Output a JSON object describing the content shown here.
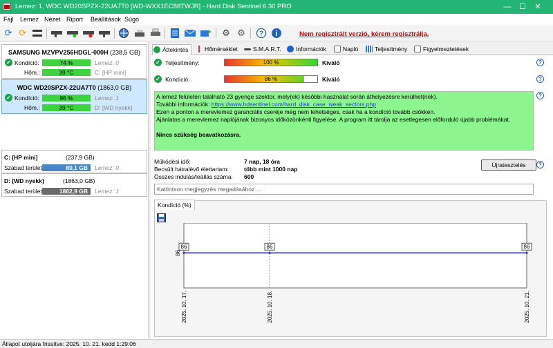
{
  "window": {
    "title": "Lemez: 1, WDC WD20SPZX-22UA7T0 [WD-WXX1EC88TWJR]  -  Hard Disk Sentinel 6.30 PRO",
    "controls": [
      "—",
      "☐",
      "✕"
    ]
  },
  "menu": [
    "Fájl",
    "Lemez",
    "Nézet",
    "Riport",
    "Beállítások",
    "Súgó"
  ],
  "toolbar": {
    "icons": [
      "refresh-icon",
      "warning-refresh-icon",
      "disk-list-icon",
      "disk-icon",
      "disk-green-icon",
      "disk-red-icon",
      "disk-remove-icon",
      "globe-icon",
      "scanner-icon",
      "printer-icon",
      "report-icon",
      "mail-icon",
      "mail-send-icon",
      "settings-gear-icon",
      "wrench-icon",
      "help-icon",
      "info-icon"
    ],
    "register_message": "Nem regisztrált verzió, kérem regisztrálja."
  },
  "disks": [
    {
      "name": "SAMSUNG MZVPV256HDGL-000H",
      "size": "(238,5 GB)",
      "kondicio_label": "Kondíció:",
      "kondicio": "74 %",
      "lemez": "Lemez: 0",
      "hom_label": "Hőm.:",
      "temp": "39 °C",
      "drive": "C: [HP mini]"
    },
    {
      "name": "WDC WD20SPZX-22UA7T0",
      "size": "(1863,0 GB)",
      "kondicio_label": "Kondíció:",
      "kondicio": "86 %",
      "lemez": "Lemez: 1",
      "hom_label": "Hőm.:",
      "temp": "39 °C",
      "drive": "D: [WD nyekk]"
    }
  ],
  "volumes": [
    {
      "name": "C: [HP mini]",
      "size": "(237,9 GB)",
      "free_label": "Szabad terület",
      "free": "80,1 GB",
      "free_fraction": 0.337,
      "disk": "Lemez: 0"
    },
    {
      "name": "D: [WD nyekk]",
      "size": "(1863,0 GB)",
      "free_label": "Szabad terület",
      "free": "1862,9 GB",
      "free_fraction": 0.999,
      "disk": "Lemez: 1"
    }
  ],
  "tabs": [
    "Áttekintés",
    "Hőmérséklet",
    "S.M.A.R.T.",
    "Információk",
    "Napló",
    "Teljesítmény",
    "Figyelmeztetések"
  ],
  "overview": {
    "perf_label": "Teljesítmény:",
    "perf_value": "100 %",
    "perf_fraction": 1.0,
    "perf_rating": "Kiváló",
    "health_label": "Kondíció:",
    "health_value": "86 %",
    "health_fraction": 0.86,
    "health_rating": "Kiváló",
    "message_line1": "A lemez felületén található 23 gyenge szektor, mely(ek) későbbi használat során áthelyezésre kerülhet(nek).",
    "message_more_label": "További információk: ",
    "message_link": "https://www.hdsentinel.com/hard_disk_case_weak_sectors.php",
    "message_line3": "Ezen a ponton a merevlemez garanciális cseréje még nem lehetséges, csak ha a kondíció tovább csökken.",
    "message_line4": "Ajánlatos a merevlemez naplójának bizonyos időközönkénti figyelése. A program itt tárolja az esetlegesen előforduló újabb problémákat.",
    "message_bold": "Nincs szükség beavatkozásra.",
    "uptime_label": "Működési idő:",
    "uptime": "7 nap, 18 óra",
    "life_label": "Becsült hátralévő élettartam:",
    "life": "több mint 1000 nap",
    "starts_label": "Összes indulás/leállás száma:",
    "starts": "600",
    "retest_button": "Újratesztelés",
    "comment_placeholder": "Kattintson megjegyzés megadásához ..."
  },
  "chart_tab": "Kondíció  (%)",
  "chart_data": {
    "type": "line",
    "x": [
      "2025. 10. 17.",
      "2025. 10. 18.",
      "2025. 10. 21."
    ],
    "series": [
      {
        "values": [
          86,
          86,
          86
        ]
      }
    ],
    "data_labels": [
      "86",
      "86",
      "86"
    ],
    "ytick": "86",
    "color": "#2222cc"
  },
  "status": "Állapot utoljára frissítve: 2025. 10. 21. kedd 1:29:06"
}
